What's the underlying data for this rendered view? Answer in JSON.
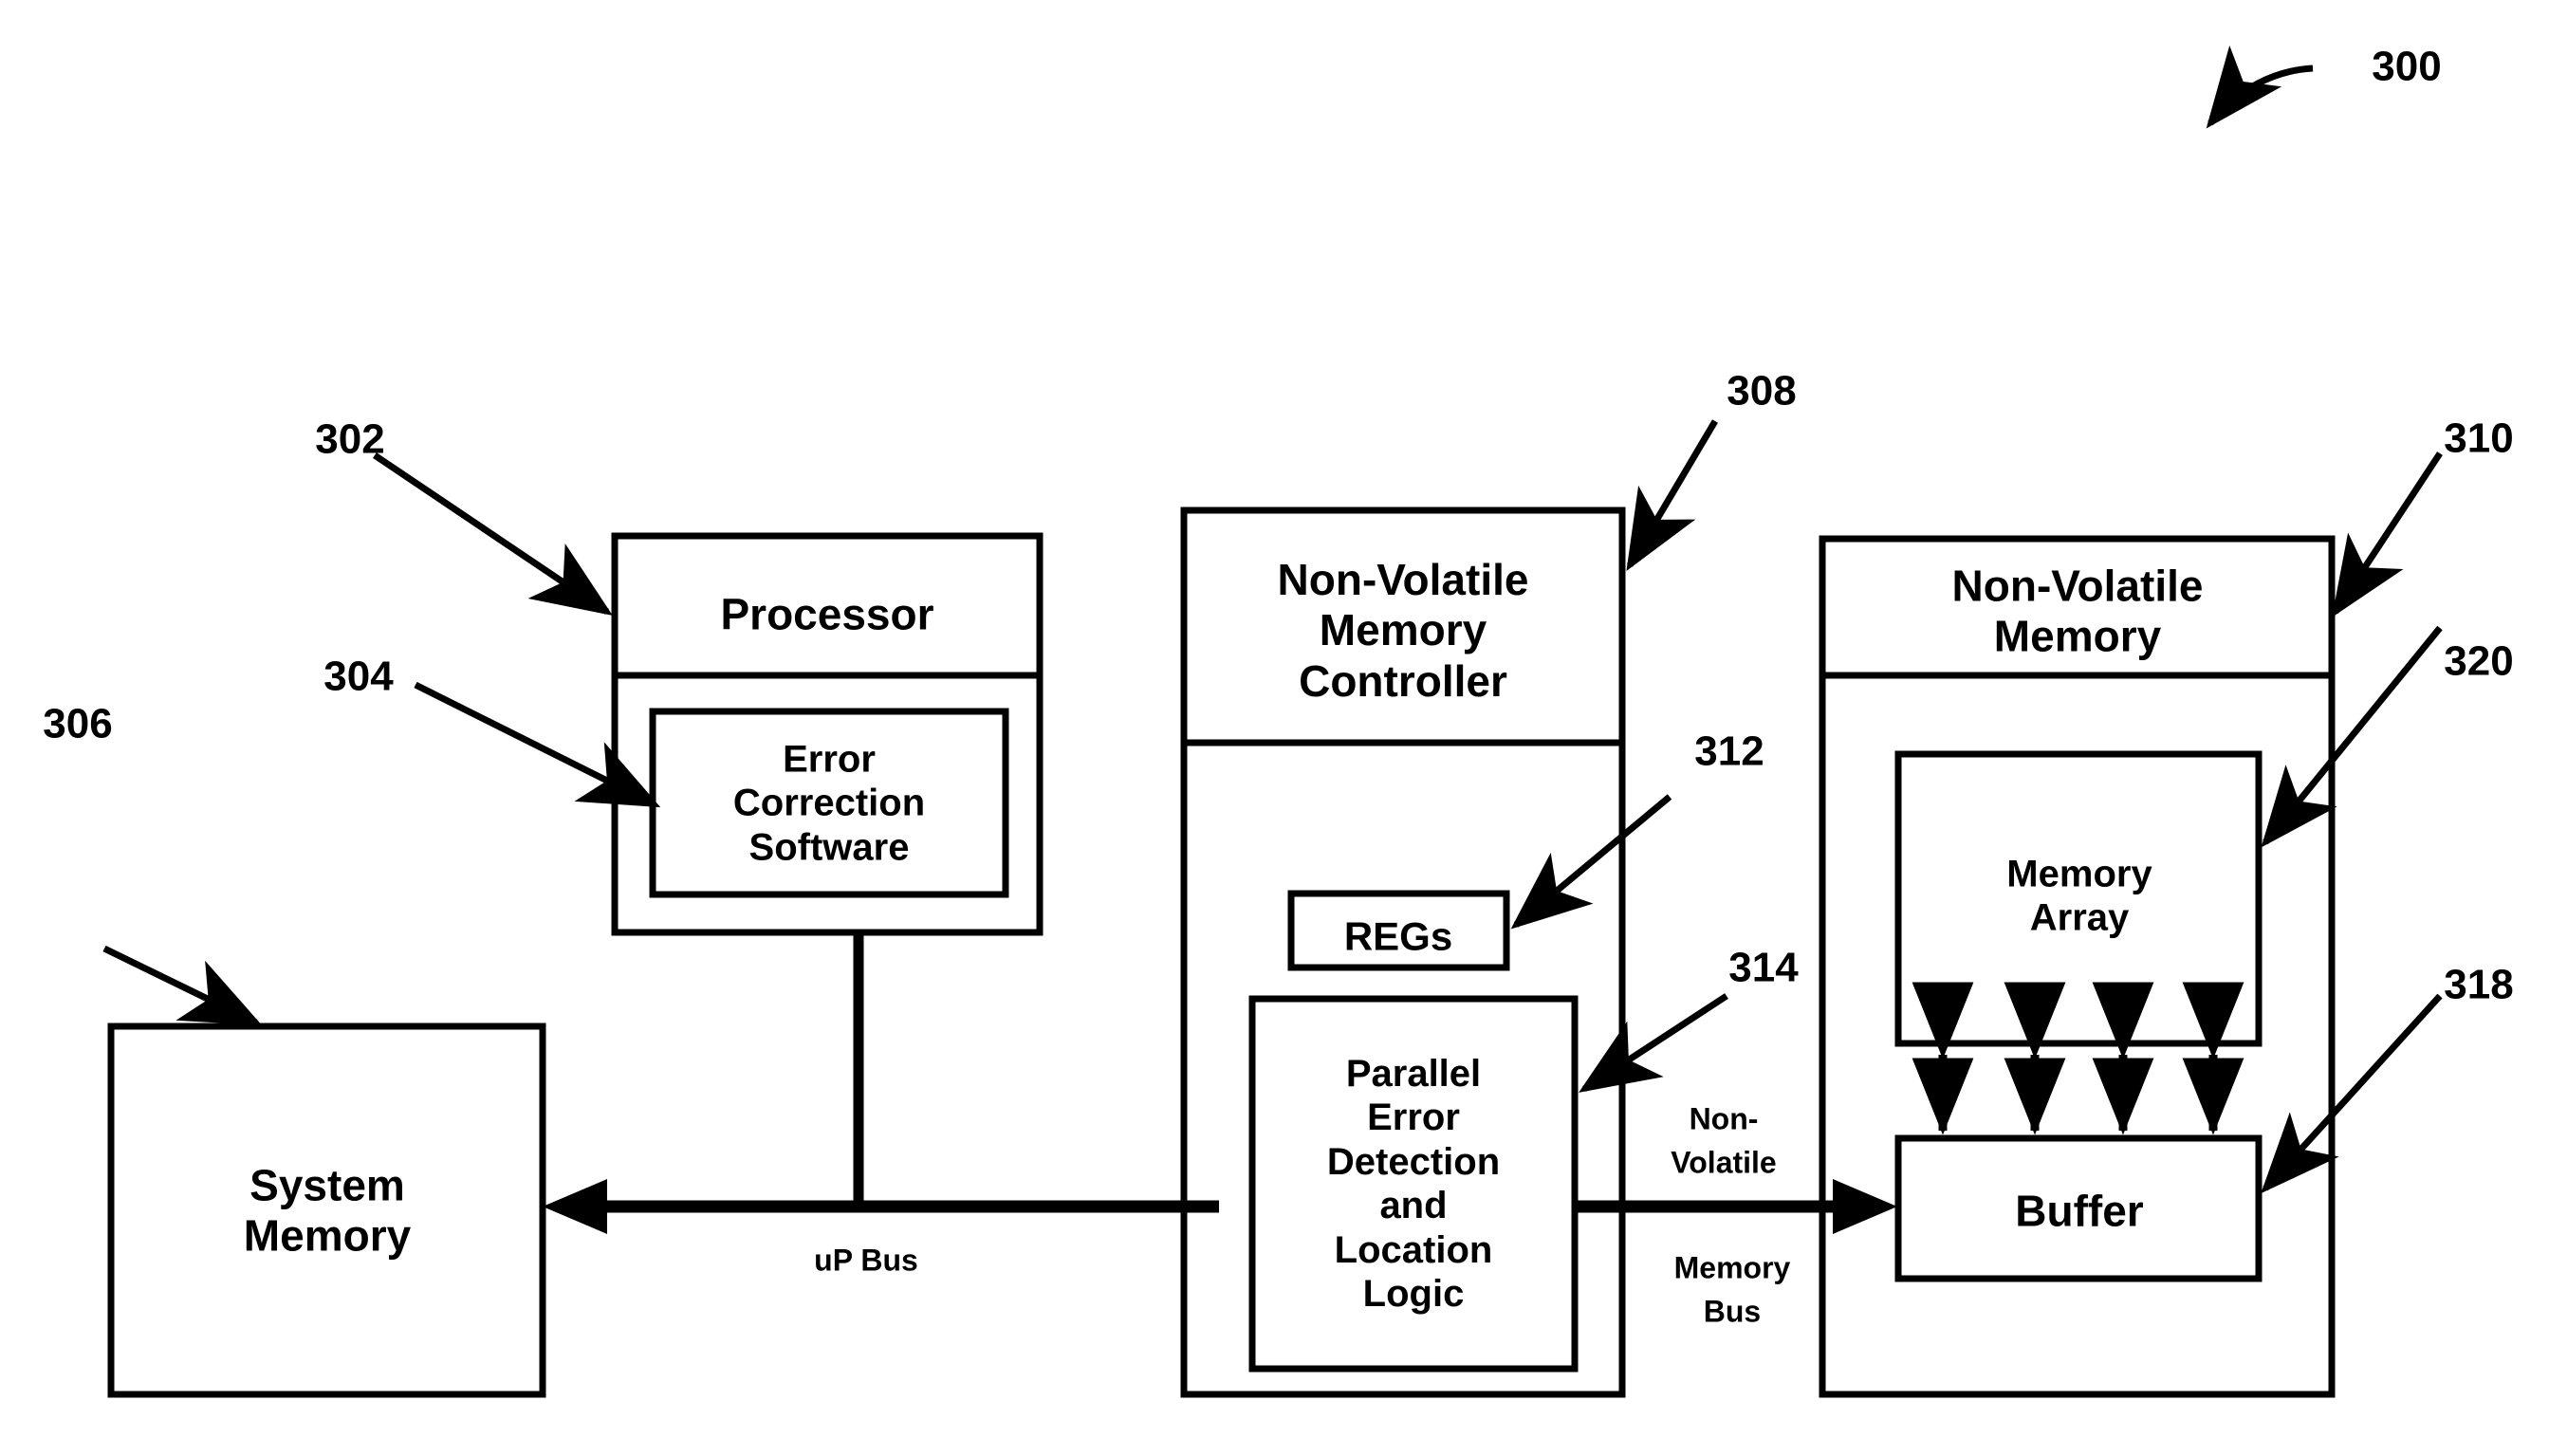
{
  "figure": {
    "number": "300",
    "type": "patent-block-diagram"
  },
  "blocks": {
    "processor": {
      "title": "Processor",
      "ref": "302",
      "inner": {
        "label": "Error\nCorrection\nSoftware",
        "ref": "304"
      }
    },
    "system_memory": {
      "title": "System\nMemory",
      "ref": "306"
    },
    "nvm_controller": {
      "title": "Non-Volatile\nMemory\nController",
      "ref": "308",
      "regs": {
        "label": "REGs",
        "ref": "312"
      },
      "pedl": {
        "label": "Parallel\nError\nDetection\nand\nLocation\nLogic",
        "ref": "314"
      }
    },
    "nvm": {
      "title": "Non-Volatile\nMemory",
      "ref": "310",
      "memory_array": {
        "label": "Memory\nArray",
        "ref": "320"
      },
      "buffer": {
        "label": "Buffer",
        "ref": "318"
      }
    }
  },
  "buses": {
    "up_bus": {
      "label": "uP Bus"
    },
    "nv_memory_bus": {
      "label_line1": "Non-",
      "label_line2": "Volatile",
      "label_line3": "Memory",
      "label_line4": "Bus"
    }
  },
  "colors": {
    "ink": "#000000",
    "paper": "#ffffff"
  }
}
